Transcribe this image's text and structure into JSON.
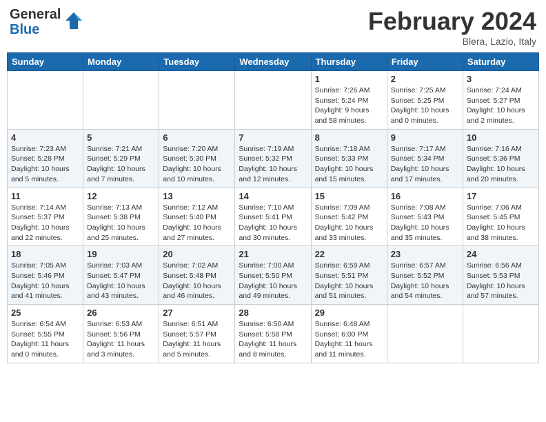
{
  "header": {
    "logo_general": "General",
    "logo_blue": "Blue",
    "month": "February 2024",
    "location": "Blera, Lazio, Italy"
  },
  "days_of_week": [
    "Sunday",
    "Monday",
    "Tuesday",
    "Wednesday",
    "Thursday",
    "Friday",
    "Saturday"
  ],
  "weeks": [
    [
      {
        "day": "",
        "info": ""
      },
      {
        "day": "",
        "info": ""
      },
      {
        "day": "",
        "info": ""
      },
      {
        "day": "",
        "info": ""
      },
      {
        "day": "1",
        "info": "Sunrise: 7:26 AM\nSunset: 5:24 PM\nDaylight: 9 hours\nand 58 minutes."
      },
      {
        "day": "2",
        "info": "Sunrise: 7:25 AM\nSunset: 5:25 PM\nDaylight: 10 hours\nand 0 minutes."
      },
      {
        "day": "3",
        "info": "Sunrise: 7:24 AM\nSunset: 5:27 PM\nDaylight: 10 hours\nand 2 minutes."
      }
    ],
    [
      {
        "day": "4",
        "info": "Sunrise: 7:23 AM\nSunset: 5:28 PM\nDaylight: 10 hours\nand 5 minutes."
      },
      {
        "day": "5",
        "info": "Sunrise: 7:21 AM\nSunset: 5:29 PM\nDaylight: 10 hours\nand 7 minutes."
      },
      {
        "day": "6",
        "info": "Sunrise: 7:20 AM\nSunset: 5:30 PM\nDaylight: 10 hours\nand 10 minutes."
      },
      {
        "day": "7",
        "info": "Sunrise: 7:19 AM\nSunset: 5:32 PM\nDaylight: 10 hours\nand 12 minutes."
      },
      {
        "day": "8",
        "info": "Sunrise: 7:18 AM\nSunset: 5:33 PM\nDaylight: 10 hours\nand 15 minutes."
      },
      {
        "day": "9",
        "info": "Sunrise: 7:17 AM\nSunset: 5:34 PM\nDaylight: 10 hours\nand 17 minutes."
      },
      {
        "day": "10",
        "info": "Sunrise: 7:16 AM\nSunset: 5:36 PM\nDaylight: 10 hours\nand 20 minutes."
      }
    ],
    [
      {
        "day": "11",
        "info": "Sunrise: 7:14 AM\nSunset: 5:37 PM\nDaylight: 10 hours\nand 22 minutes."
      },
      {
        "day": "12",
        "info": "Sunrise: 7:13 AM\nSunset: 5:38 PM\nDaylight: 10 hours\nand 25 minutes."
      },
      {
        "day": "13",
        "info": "Sunrise: 7:12 AM\nSunset: 5:40 PM\nDaylight: 10 hours\nand 27 minutes."
      },
      {
        "day": "14",
        "info": "Sunrise: 7:10 AM\nSunset: 5:41 PM\nDaylight: 10 hours\nand 30 minutes."
      },
      {
        "day": "15",
        "info": "Sunrise: 7:09 AM\nSunset: 5:42 PM\nDaylight: 10 hours\nand 33 minutes."
      },
      {
        "day": "16",
        "info": "Sunrise: 7:08 AM\nSunset: 5:43 PM\nDaylight: 10 hours\nand 35 minutes."
      },
      {
        "day": "17",
        "info": "Sunrise: 7:06 AM\nSunset: 5:45 PM\nDaylight: 10 hours\nand 38 minutes."
      }
    ],
    [
      {
        "day": "18",
        "info": "Sunrise: 7:05 AM\nSunset: 5:46 PM\nDaylight: 10 hours\nand 41 minutes."
      },
      {
        "day": "19",
        "info": "Sunrise: 7:03 AM\nSunset: 5:47 PM\nDaylight: 10 hours\nand 43 minutes."
      },
      {
        "day": "20",
        "info": "Sunrise: 7:02 AM\nSunset: 5:48 PM\nDaylight: 10 hours\nand 46 minutes."
      },
      {
        "day": "21",
        "info": "Sunrise: 7:00 AM\nSunset: 5:50 PM\nDaylight: 10 hours\nand 49 minutes."
      },
      {
        "day": "22",
        "info": "Sunrise: 6:59 AM\nSunset: 5:51 PM\nDaylight: 10 hours\nand 51 minutes."
      },
      {
        "day": "23",
        "info": "Sunrise: 6:57 AM\nSunset: 5:52 PM\nDaylight: 10 hours\nand 54 minutes."
      },
      {
        "day": "24",
        "info": "Sunrise: 6:56 AM\nSunset: 5:53 PM\nDaylight: 10 hours\nand 57 minutes."
      }
    ],
    [
      {
        "day": "25",
        "info": "Sunrise: 6:54 AM\nSunset: 5:55 PM\nDaylight: 11 hours\nand 0 minutes."
      },
      {
        "day": "26",
        "info": "Sunrise: 6:53 AM\nSunset: 5:56 PM\nDaylight: 11 hours\nand 3 minutes."
      },
      {
        "day": "27",
        "info": "Sunrise: 6:51 AM\nSunset: 5:57 PM\nDaylight: 11 hours\nand 5 minutes."
      },
      {
        "day": "28",
        "info": "Sunrise: 6:50 AM\nSunset: 5:58 PM\nDaylight: 11 hours\nand 8 minutes."
      },
      {
        "day": "29",
        "info": "Sunrise: 6:48 AM\nSunset: 6:00 PM\nDaylight: 11 hours\nand 11 minutes."
      },
      {
        "day": "",
        "info": ""
      },
      {
        "day": "",
        "info": ""
      }
    ]
  ]
}
